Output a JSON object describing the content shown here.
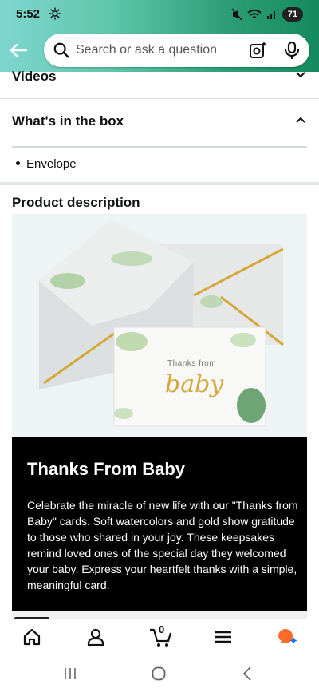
{
  "status_bar": {
    "time": "5:52",
    "battery": "71"
  },
  "search": {
    "placeholder": "Search or ask a question"
  },
  "sections": {
    "videos_label": "Videos",
    "whats_in_box_label": "What's in the box",
    "box_items": [
      "Envelope"
    ],
    "product_description_label": "Product description"
  },
  "hero_card": {
    "line1": "Thanks from",
    "line2": "baby"
  },
  "promo": {
    "title": "Thanks From Baby",
    "body": "Celebrate the miracle of new life with our \"Thanks from Baby\" cards. Soft watercolors and gold show gratitude to those who shared in your joy. These keepsakes remind loved ones of the special day they welcomed your baby. Express your heartfelt thanks with a simple, meaningful card."
  },
  "cart": {
    "count": "0"
  },
  "colors": {
    "header_start": "#7fd6d0",
    "header_end": "#148a5e",
    "promo_bg": "#000000",
    "gold": "#d4a73a",
    "rufus_orange": "#ff6a2b",
    "rufus_blue": "#1a73e8"
  },
  "icons": [
    "settings-icon",
    "mute-icon",
    "wifi-icon",
    "signal-icon",
    "battery-icon",
    "back-arrow-icon",
    "search-icon",
    "camera-lens-icon",
    "microphone-icon",
    "chevron-down-icon",
    "chevron-up-icon",
    "home-icon",
    "account-icon",
    "cart-icon",
    "menu-icon",
    "rufus-icon",
    "recents-icon",
    "home-circle-icon",
    "system-back-icon"
  ]
}
